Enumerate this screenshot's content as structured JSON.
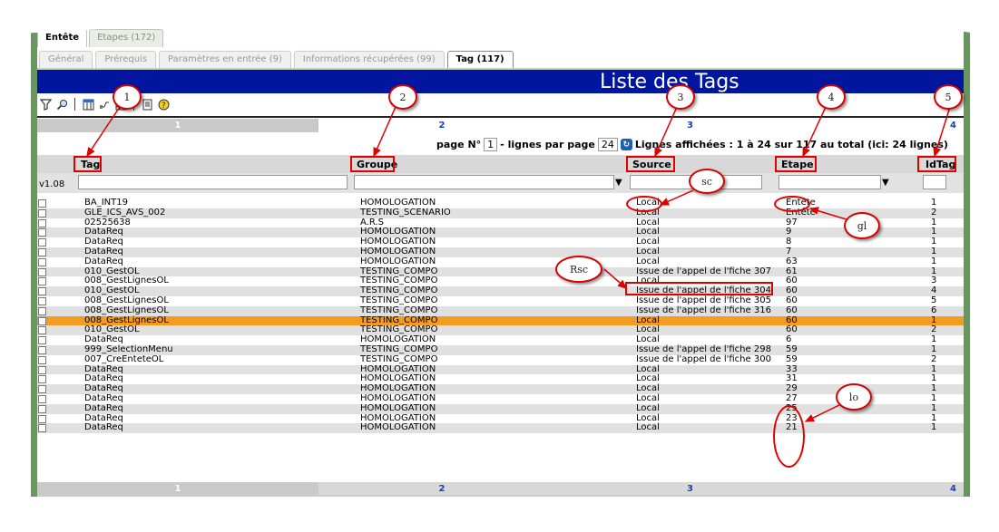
{
  "tabs_main": [
    {
      "label": "Entête",
      "active": true
    },
    {
      "label": "Etapes (172)",
      "active": false
    }
  ],
  "tabs_sub": [
    {
      "label": "Général"
    },
    {
      "label": "Prérequis"
    },
    {
      "label": "Paramètres en entrée (9)"
    },
    {
      "label": "Informations récupérées (99)"
    },
    {
      "label": "Tag (117)",
      "active": true
    }
  ],
  "title": "Liste des Tags",
  "col_indexes": [
    "1",
    "2",
    "3",
    "4"
  ],
  "pager": {
    "page_label": "page N°",
    "page": "1",
    "lines_label": "- lignes par page",
    "per_page": "24",
    "summary": "Lignes affichées : 1 à 24 sur 117 au total (ici: 24 lignes)"
  },
  "columns": {
    "tag": "Tag",
    "groupe": "Groupe",
    "source": "Source",
    "etape": "Etape",
    "idtag": "IdTag"
  },
  "version": "v1.08",
  "rows": [
    [
      "BA_INT19",
      "HOMOLOGATION",
      "Local",
      "Entête",
      "1"
    ],
    [
      "GLE_ICS_AVS_002",
      "TESTING_SCENARIO",
      "Local",
      "Entête",
      "2"
    ],
    [
      "02525638",
      "A.R.S",
      "Local",
      "97",
      "1"
    ],
    [
      "DataReq",
      "HOMOLOGATION",
      "Local",
      "9",
      "1"
    ],
    [
      "DataReq",
      "HOMOLOGATION",
      "Local",
      "8",
      "1"
    ],
    [
      "DataReq",
      "HOMOLOGATION",
      "Local",
      "7",
      "1"
    ],
    [
      "DataReq",
      "HOMOLOGATION",
      "Local",
      "63",
      "1"
    ],
    [
      "010_GestOL",
      "TESTING_COMPO",
      "Issue de l'appel de l'fiche 307",
      "61",
      "1"
    ],
    [
      "008_GestLignesOL",
      "TESTING_COMPO",
      "Local",
      "60",
      "3"
    ],
    [
      "010_GestOL",
      "TESTING_COMPO",
      "Issue de l'appel de l'fiche 304",
      "60",
      "4"
    ],
    [
      "008_GestLignesOL",
      "TESTING_COMPO",
      "Issue de l'appel de l'fiche 305",
      "60",
      "5"
    ],
    [
      "008_GestLignesOL",
      "TESTING_COMPO",
      "Issue de l'appel de l'fiche 316",
      "60",
      "6"
    ],
    [
      "008_GestLignesOL",
      "TESTING_COMPO",
      "Local",
      "60",
      "1"
    ],
    [
      "010_GestOL",
      "TESTING_COMPO",
      "Local",
      "60",
      "2"
    ],
    [
      "DataReq",
      "HOMOLOGATION",
      "Local",
      "6",
      "1"
    ],
    [
      "999_SelectionMenu",
      "TESTING_COMPO",
      "Issue de l'appel de l'fiche 298",
      "59",
      "1"
    ],
    [
      "007_CreEnteteOL",
      "TESTING_COMPO",
      "Issue de l'appel de l'fiche 300",
      "59",
      "2"
    ],
    [
      "DataReq",
      "HOMOLOGATION",
      "Local",
      "33",
      "1"
    ],
    [
      "DataReq",
      "HOMOLOGATION",
      "Local",
      "31",
      "1"
    ],
    [
      "DataReq",
      "HOMOLOGATION",
      "Local",
      "29",
      "1"
    ],
    [
      "DataReq",
      "HOMOLOGATION",
      "Local",
      "27",
      "1"
    ],
    [
      "DataReq",
      "HOMOLOGATION",
      "Local",
      "25",
      "1"
    ],
    [
      "DataReq",
      "HOMOLOGATION",
      "Local",
      "23",
      "1"
    ],
    [
      "DataReq",
      "HOMOLOGATION",
      "Local",
      "21",
      "1"
    ]
  ],
  "highlight_color": "#f49b22",
  "title_bar_color": "#00169e",
  "annotations": {
    "n1": "1",
    "n2": "2",
    "n3": "3",
    "n4": "4",
    "n5": "5",
    "sc": "sc",
    "gl": "gl",
    "rsc": "Rsc",
    "lo": "lo"
  },
  "toolbar_icons": [
    "filter-icon",
    "search-icon",
    "columns-icon",
    "link-icon",
    "grid-icon",
    "export-icon",
    "help-icon"
  ]
}
